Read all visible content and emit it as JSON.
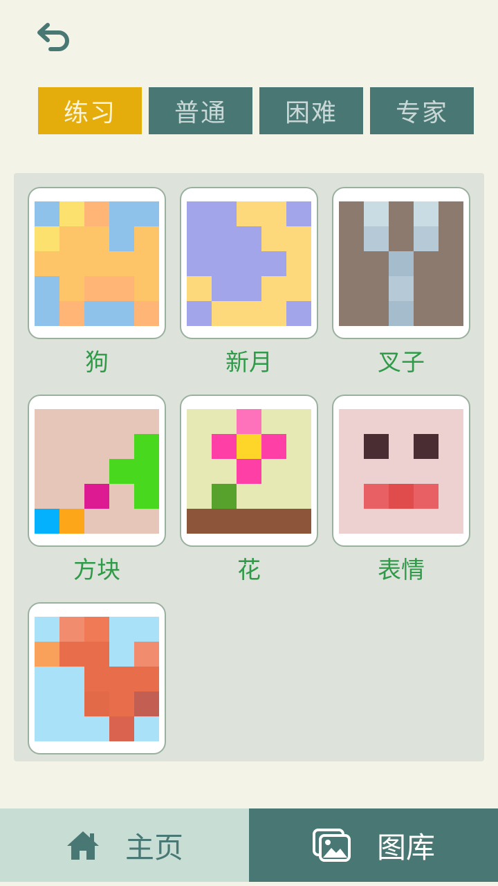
{
  "colors": {
    "background": "#f4f3e8",
    "tab_active": "#e5ad0b",
    "tab_inactive": "#497874",
    "label_green": "#2f9a48",
    "nav_home_bg": "#c8ddd4",
    "nav_gallery_bg": "#497874"
  },
  "header": {
    "back_icon": "undo-arrow-icon"
  },
  "tabs": [
    {
      "label": "练习",
      "selected": true
    },
    {
      "label": "普通",
      "selected": false
    },
    {
      "label": "困难",
      "selected": false
    },
    {
      "label": "专家",
      "selected": false
    }
  ],
  "puzzles": [
    {
      "label": "狗",
      "pixels": [
        [
          "#8ec2ea",
          "#fde16f",
          "#feb575",
          "#8ec2ea",
          "#8ec2ea"
        ],
        [
          "#fde16f",
          "#fec468",
          "#fec468",
          "#8ec2ea",
          "#fec468"
        ],
        [
          "#fec468",
          "#fec468",
          "#fec468",
          "#fec468",
          "#fec468"
        ],
        [
          "#8ec2ea",
          "#fec468",
          "#feb575",
          "#feb575",
          "#fec468"
        ],
        [
          "#8ec2ea",
          "#feb575",
          "#8ec2ea",
          "#8ec2ea",
          "#feb575"
        ]
      ]
    },
    {
      "label": "新月",
      "pixels": [
        [
          "#a2a5ea",
          "#a2a5ea",
          "#fed97b",
          "#fed97b",
          "#a2a5ea"
        ],
        [
          "#a2a5ea",
          "#a2a5ea",
          "#a2a5ea",
          "#fed97b",
          "#fed97b"
        ],
        [
          "#a2a5ea",
          "#a2a5ea",
          "#a2a5ea",
          "#a2a5ea",
          "#fed97b"
        ],
        [
          "#fed97b",
          "#a2a5ea",
          "#a2a5ea",
          "#fed97b",
          "#fed97b"
        ],
        [
          "#a2a5ea",
          "#fed97b",
          "#fed97b",
          "#fed97b",
          "#a2a5ea"
        ]
      ]
    },
    {
      "label": "叉子",
      "pixels": [
        [
          "#8c7a6e",
          "#c9dbe3",
          "#8c7a6e",
          "#c9dbe3",
          "#8c7a6e"
        ],
        [
          "#8c7a6e",
          "#b5cad6",
          "#8c7a6e",
          "#b5cad6",
          "#8c7a6e"
        ],
        [
          "#8c7a6e",
          "#8c7a6e",
          "#a5bccc",
          "#8c7a6e",
          "#8c7a6e"
        ],
        [
          "#8c7a6e",
          "#8c7a6e",
          "#b5cad6",
          "#8c7a6e",
          "#8c7a6e"
        ],
        [
          "#8c7a6e",
          "#8c7a6e",
          "#a5bccc",
          "#8c7a6e",
          "#8c7a6e"
        ]
      ]
    },
    {
      "label": "方块",
      "pixels": [
        [
          "#e7c6ba",
          "#e7c6ba",
          "#e7c6ba",
          "#e7c6ba",
          "#e7c6ba"
        ],
        [
          "#e7c6ba",
          "#e7c6ba",
          "#e7c6ba",
          "#e7c6ba",
          "#48d81e"
        ],
        [
          "#e7c6ba",
          "#e7c6ba",
          "#e7c6ba",
          "#48d81e",
          "#48d81e"
        ],
        [
          "#e7c6ba",
          "#e7c6ba",
          "#dd1a91",
          "#e7c6ba",
          "#48d81e"
        ],
        [
          "#04b1fc",
          "#fea61a",
          "#e7c6ba",
          "#e7c6ba",
          "#e7c6ba"
        ]
      ]
    },
    {
      "label": "花",
      "pixels": [
        [
          "#e7e9b5",
          "#e7e9b5",
          "#fe72bc",
          "#e7e9b5",
          "#e7e9b5"
        ],
        [
          "#e7e9b5",
          "#fe3fa5",
          "#fed629",
          "#fe3fa5",
          "#e7e9b5"
        ],
        [
          "#e7e9b5",
          "#e7e9b5",
          "#fe3fa5",
          "#e7e9b5",
          "#e7e9b5"
        ],
        [
          "#e7e9b5",
          "#56a22d",
          "#e7e9b5",
          "#e7e9b5",
          "#e7e9b5"
        ],
        [
          "#8d563a",
          "#8d563a",
          "#8d563a",
          "#8d563a",
          "#8d563a"
        ]
      ]
    },
    {
      "label": "表情",
      "pixels": [
        [
          "#edd1d1",
          "#edd1d1",
          "#edd1d1",
          "#edd1d1",
          "#edd1d1"
        ],
        [
          "#edd1d1",
          "#4a2c33",
          "#edd1d1",
          "#4a2c33",
          "#edd1d1"
        ],
        [
          "#edd1d1",
          "#edd1d1",
          "#edd1d1",
          "#edd1d1",
          "#edd1d1"
        ],
        [
          "#edd1d1",
          "#e85f64",
          "#e04b4b",
          "#e85f64",
          "#edd1d1"
        ],
        [
          "#edd1d1",
          "#edd1d1",
          "#edd1d1",
          "#edd1d1",
          "#edd1d1"
        ]
      ]
    },
    {
      "label": "",
      "pixels": [
        [
          "#a9e1f8",
          "#f28c6e",
          "#ef7a55",
          "#a9e1f8",
          "#a9e1f8"
        ],
        [
          "#f9a05a",
          "#e86d4b",
          "#e86d4b",
          "#a9e1f8",
          "#f28c6e"
        ],
        [
          "#a9e1f8",
          "#a9e1f8",
          "#e86d4b",
          "#e86d4b",
          "#e86d4b"
        ],
        [
          "#a9e1f8",
          "#a9e1f8",
          "#e26a48",
          "#e86d4b",
          "#c35f52"
        ],
        [
          "#a9e1f8",
          "#a9e1f8",
          "#a9e1f8",
          "#d9634f",
          "#a9e1f8"
        ]
      ]
    }
  ],
  "bottom_nav": {
    "home": {
      "label": "主页",
      "icon": "home-icon",
      "selected": false
    },
    "gallery": {
      "label": "图库",
      "icon": "gallery-icon",
      "selected": true
    }
  }
}
